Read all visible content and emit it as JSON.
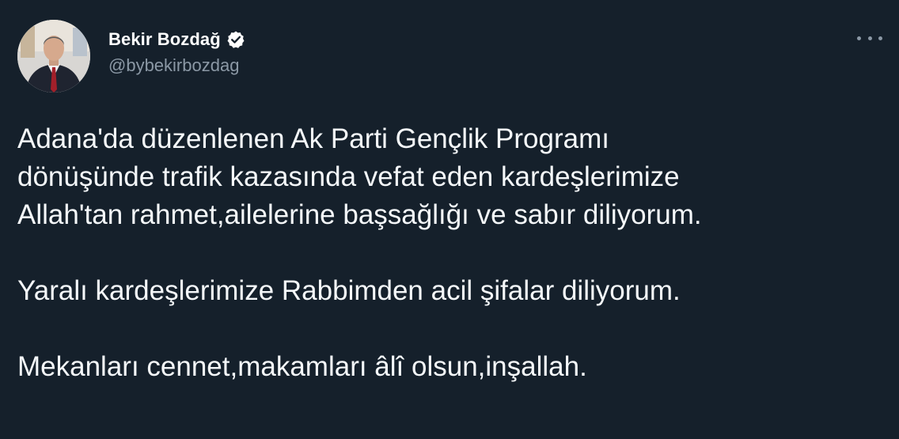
{
  "author": {
    "display_name": "Bekir Bozdağ",
    "handle": "@bybekirbozdag",
    "verified": true,
    "avatar_icon": "profile-photo"
  },
  "tweet": {
    "lines": [
      "Adana'da düzenlenen Ak Parti Gençlik Programı",
      "dönüşünde trafik kazasında vefat eden kardeşlerimize",
      "Allah'tan rahmet,ailelerine başsağlığı ve sabır diliyorum.",
      "",
      "Yaralı kardeşlerimize Rabbimden acil şifalar diliyorum.",
      "",
      "Mekanları cennet,makamları âlî olsun,inşallah."
    ]
  },
  "colors": {
    "background": "#15202b",
    "text": "#f5f8fa",
    "secondary": "#8b98a5",
    "verified_badge": "#ffffff"
  }
}
